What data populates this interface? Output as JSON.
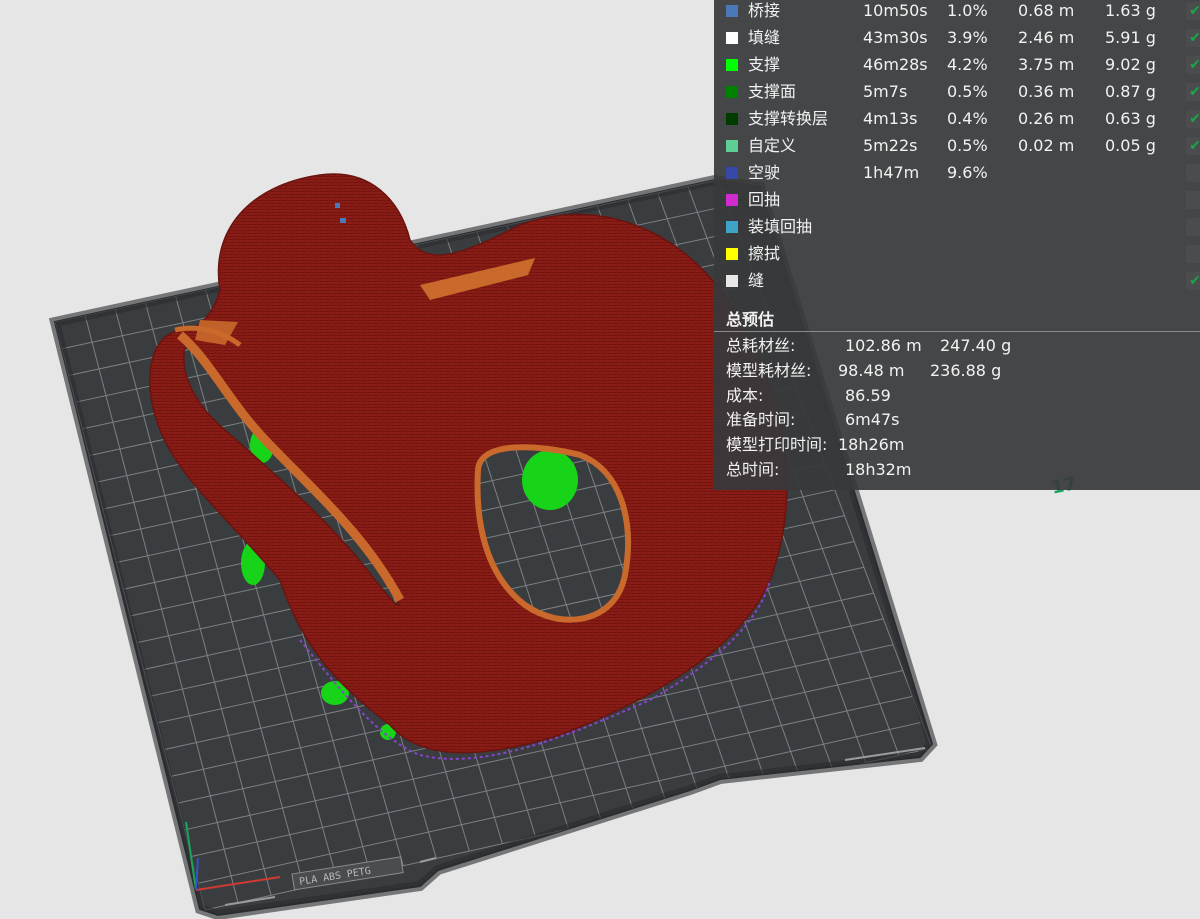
{
  "legend": [
    {
      "name": "桥接",
      "color": "#4a78b8",
      "time": "10m50s",
      "pct": "1.0%",
      "length": "0.68 m",
      "weight": "1.63 g",
      "checked": true
    },
    {
      "name": "填缝",
      "color": "#ffffff",
      "time": "43m30s",
      "pct": "3.9%",
      "length": "2.46 m",
      "weight": "5.91 g",
      "checked": true
    },
    {
      "name": "支撑",
      "color": "#00ff00",
      "time": "46m28s",
      "pct": "4.2%",
      "length": "3.75 m",
      "weight": "9.02 g",
      "checked": true
    },
    {
      "name": "支撑面",
      "color": "#008000",
      "time": "5m7s",
      "pct": "0.5%",
      "length": "0.36 m",
      "weight": "0.87 g",
      "checked": true
    },
    {
      "name": "支撑转换层",
      "color": "#003c00",
      "time": "4m13s",
      "pct": "0.4%",
      "length": "0.26 m",
      "weight": "0.63 g",
      "checked": true
    },
    {
      "name": "自定义",
      "color": "#5ecf94",
      "time": "5m22s",
      "pct": "0.5%",
      "length": "0.02 m",
      "weight": "0.05 g",
      "checked": true
    },
    {
      "name": "空驶",
      "color": "#3848a8",
      "time": "1h47m",
      "pct": "9.6%",
      "length": "",
      "weight": "",
      "checked": false
    },
    {
      "name": "回抽",
      "color": "#d12ad1",
      "time": "",
      "pct": "",
      "length": "",
      "weight": "",
      "checked": false
    },
    {
      "name": "装填回抽",
      "color": "#3fa3c8",
      "time": "",
      "pct": "",
      "length": "",
      "weight": "",
      "checked": false
    },
    {
      "name": "擦拭",
      "color": "#ffff00",
      "time": "",
      "pct": "",
      "length": "",
      "weight": "",
      "checked": false
    },
    {
      "name": "缝",
      "color": "#e8e8e8",
      "time": "",
      "pct": "",
      "length": "",
      "weight": "",
      "checked": true
    }
  ],
  "summary": {
    "title": "总预估",
    "rows": [
      {
        "label": "总耗材丝:",
        "v1": "102.86 m",
        "v2": "247.40 g"
      },
      {
        "label": "模型耗材丝:",
        "v1": "98.48 m",
        "v2": "236.88 g"
      },
      {
        "label": "成本:",
        "v1": "86.59",
        "v2": ""
      },
      {
        "label": "准备时间:",
        "v1": "6m47s",
        "v2": ""
      },
      {
        "label": "模型打印时间:",
        "v1": "18h26m",
        "v2": ""
      },
      {
        "label": "总时间:",
        "v1": "18h32m",
        "v2": ""
      }
    ]
  },
  "viewport": {
    "layer_label": "17",
    "plate_label": "PLA ABS PETG"
  },
  "colors": {
    "model": "#8b1d17",
    "model_edge": "#c9692b",
    "support": "#18d418",
    "plate": "#3a3d40",
    "grid": "#7d8083"
  }
}
